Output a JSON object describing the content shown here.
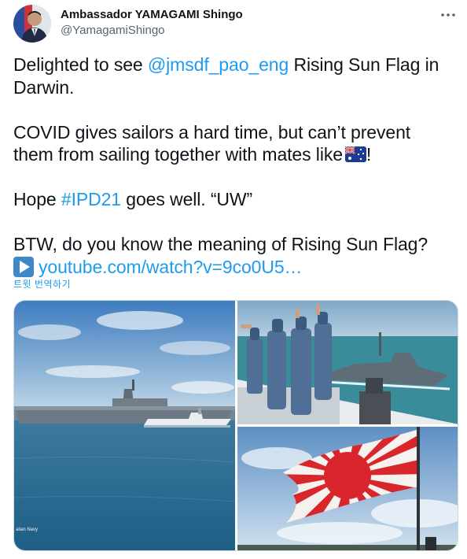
{
  "author": {
    "name": "Ambassador YAMAGAMI Shingo",
    "handle": "@YamagamiShingo"
  },
  "tweet": {
    "line1_pre": "Delighted to see ",
    "mention": "@jmsdf_pao_eng",
    "line1_post": " Rising Sun Flag in",
    "line2": "Darwin.",
    "line3": "COVID gives sailors a hard time, but can’t prevent",
    "line4": "them from sailing together with mates like",
    "line4_end": "!",
    "line5_pre": "Hope ",
    "hashtag": "#IPD21",
    "line5_post": " goes well. “UW”",
    "line6": "BTW, do you know the meaning of Rising Sun Flag?",
    "link": "youtube.com/watch?v=9co0U5…"
  },
  "translate_label": "트윗 번역하기",
  "media": {
    "photo1_caption": "alian Navy"
  },
  "icons": {
    "more": "more-horizontal-icon",
    "flag": "australia-flag-emoji",
    "play": "play-button-emoji"
  },
  "colors": {
    "link": "#1d9bf0",
    "text": "#0f1419",
    "secondary": "#536471"
  }
}
